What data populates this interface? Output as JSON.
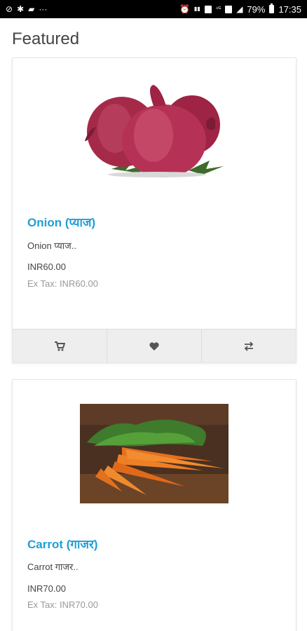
{
  "status_bar": {
    "battery": "79%",
    "time": "17:35",
    "left_icons": [
      "link-icon",
      "gear-icon",
      "message-icon",
      "more-icon"
    ],
    "right_icons": [
      "alarm-icon",
      "vibrate-icon",
      "data-icon",
      "volte-icon",
      "4g-icon",
      "signal-icon",
      "battery-icon"
    ]
  },
  "section": {
    "title": "Featured"
  },
  "products": [
    {
      "name": "Onion (प्याज)",
      "description": "Onion प्याज..",
      "price": "INR60.00",
      "ex_tax": "Ex Tax: INR60.00",
      "image": "onion-image"
    },
    {
      "name": "Carrot (गाजर)",
      "description": "Carrot गाजर..",
      "price": "INR70.00",
      "ex_tax": "Ex Tax: INR70.00",
      "image": "carrot-image"
    }
  ],
  "card_buttons": [
    "cart-icon",
    "heart-icon",
    "compare-icon"
  ],
  "colors": {
    "accent": "#1e9fd6",
    "button_bg": "#eeeeee",
    "icon": "#555555"
  }
}
